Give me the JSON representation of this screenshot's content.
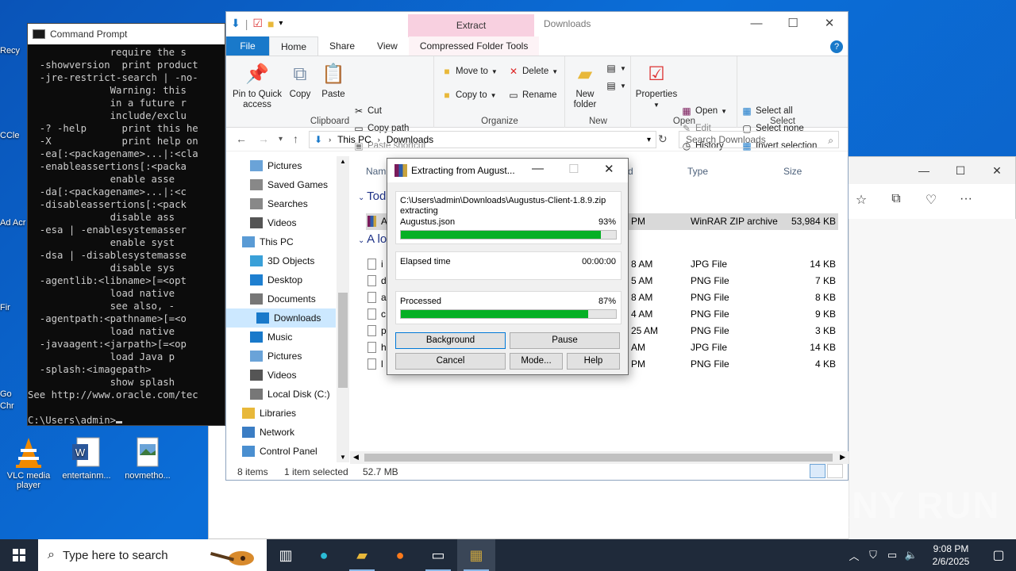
{
  "desktop": {
    "icons": [
      {
        "label": "VLC media player",
        "icon": "vlc-icon"
      },
      {
        "label": "entertainm...",
        "icon": "word-document-icon"
      },
      {
        "label": "novmetho...",
        "icon": "image-file-icon"
      }
    ],
    "left_clipped_labels": [
      "Recy",
      "CCle",
      "Ad Acr",
      "Fir",
      "Go Chr"
    ]
  },
  "cmd": {
    "title": "Command Prompt",
    "lines": [
      "              require the s",
      "  -showversion  print product",
      "  -jre-restrict-search | -no-",
      "              Warning: this",
      "              in a future r",
      "              include/exclu",
      "  -? -help      print this he",
      "  -X            print help on",
      "  -ea[:<packagename>...|:<cla",
      "  -enableassertions[:<packa",
      "              enable asse",
      "  -da[:<packagename>...|:<c",
      "  -disableassertions[:<pack",
      "              disable ass",
      "  -esa | -enablesystemasser",
      "              enable syst",
      "  -dsa | -disablesystemasse",
      "              disable sys",
      "  -agentlib:<libname>[=<opt",
      "              load native",
      "              see also, -",
      "  -agentpath:<pathname>[=<o",
      "              load native",
      "  -javaagent:<jarpath>[=<op",
      "              load Java p",
      "  -splash:<imagepath>",
      "              show splash",
      "See http://www.oracle.com/tec",
      "",
      "C:\\Users\\admin>"
    ]
  },
  "explorer": {
    "window_title": "Downloads",
    "context_tab_header": "Extract",
    "tabs": [
      "File",
      "Home",
      "Share",
      "View",
      "Compressed Folder Tools"
    ],
    "ribbon": {
      "clipboard": {
        "label": "Clipboard",
        "pin": "Pin to Quick access",
        "copy": "Copy",
        "paste": "Paste",
        "cut": "Cut",
        "copy_path": "Copy path",
        "paste_shortcut": "Paste shortcut"
      },
      "organize": {
        "label": "Organize",
        "move_to": "Move to",
        "copy_to": "Copy to",
        "delete": "Delete",
        "rename": "Rename"
      },
      "new": {
        "label": "New",
        "new_folder": "New folder"
      },
      "open": {
        "label": "Open",
        "properties": "Properties",
        "open": "Open",
        "edit": "Edit",
        "history": "History"
      },
      "select": {
        "label": "Select",
        "select_all": "Select all",
        "select_none": "Select none",
        "invert": "Invert selection"
      }
    },
    "address": {
      "crumbs": [
        "This PC",
        "Downloads"
      ],
      "search_placeholder": "Search Downloads"
    },
    "nav": [
      {
        "label": "Pictures",
        "icon": "pictures-icon"
      },
      {
        "label": "Saved Games",
        "icon": "saved-games-icon"
      },
      {
        "label": "Searches",
        "icon": "search-folder-icon"
      },
      {
        "label": "Videos",
        "icon": "videos-icon"
      },
      {
        "label": "This PC",
        "icon": "this-pc-icon"
      },
      {
        "label": "3D Objects",
        "icon": "3d-objects-icon"
      },
      {
        "label": "Desktop",
        "icon": "desktop-folder-icon"
      },
      {
        "label": "Documents",
        "icon": "documents-icon"
      },
      {
        "label": "Downloads",
        "icon": "downloads-icon"
      },
      {
        "label": "Music",
        "icon": "music-icon"
      },
      {
        "label": "Pictures",
        "icon": "pictures-icon"
      },
      {
        "label": "Videos",
        "icon": "videos-icon"
      },
      {
        "label": "Local Disk (C:)",
        "icon": "local-disk-icon"
      },
      {
        "label": "Libraries",
        "icon": "libraries-icon"
      },
      {
        "label": "Network",
        "icon": "network-icon"
      },
      {
        "label": "Control Panel",
        "icon": "control-panel-icon"
      }
    ],
    "columns": {
      "name": "Nam",
      "date": "d",
      "type": "Type",
      "size": "Size"
    },
    "groups": [
      "Tod",
      "A lo"
    ],
    "files": [
      {
        "name": "A",
        "date": "PM",
        "type": "WinRAR ZIP archive",
        "size": "53,984 KB",
        "selected": true
      },
      {
        "name": "i",
        "date": "8 AM",
        "type": "JPG File",
        "size": "14 KB"
      },
      {
        "name": "d",
        "date": "5 AM",
        "type": "PNG File",
        "size": "7 KB"
      },
      {
        "name": "a",
        "date": "8 AM",
        "type": "PNG File",
        "size": "8 KB"
      },
      {
        "name": "c",
        "date": "4 AM",
        "type": "PNG File",
        "size": "9 KB"
      },
      {
        "name": "p",
        "date": "25 AM",
        "type": "PNG File",
        "size": "3 KB"
      },
      {
        "name": "h",
        "date": "AM",
        "type": "JPG File",
        "size": "14 KB"
      },
      {
        "name": "l",
        "date": "PM",
        "type": "PNG File",
        "size": "4 KB"
      }
    ],
    "status": {
      "items": "8 items",
      "selected": "1 item selected",
      "size": "52.7 MB"
    }
  },
  "winrar": {
    "title": "Extracting from August...",
    "archive_path": "C:\\Users\\admin\\Downloads\\Augustus-Client-1.8.9.zip",
    "action": "extracting",
    "current_file": "Augustus.json",
    "file_percent_label": "93%",
    "file_progress": 0.93,
    "elapsed_label": "Elapsed time",
    "elapsed_value": "00:00:00",
    "processed_label": "Processed",
    "processed_percent_label": "87%",
    "processed_progress": 0.87,
    "buttons": {
      "background": "Background",
      "pause": "Pause",
      "cancel": "Cancel",
      "mode": "Mode...",
      "help": "Help"
    }
  },
  "watermark": "ANY RUN",
  "taskbar": {
    "search_placeholder": "Type here to search",
    "time": "9:08 PM",
    "date": "2/6/2025"
  }
}
